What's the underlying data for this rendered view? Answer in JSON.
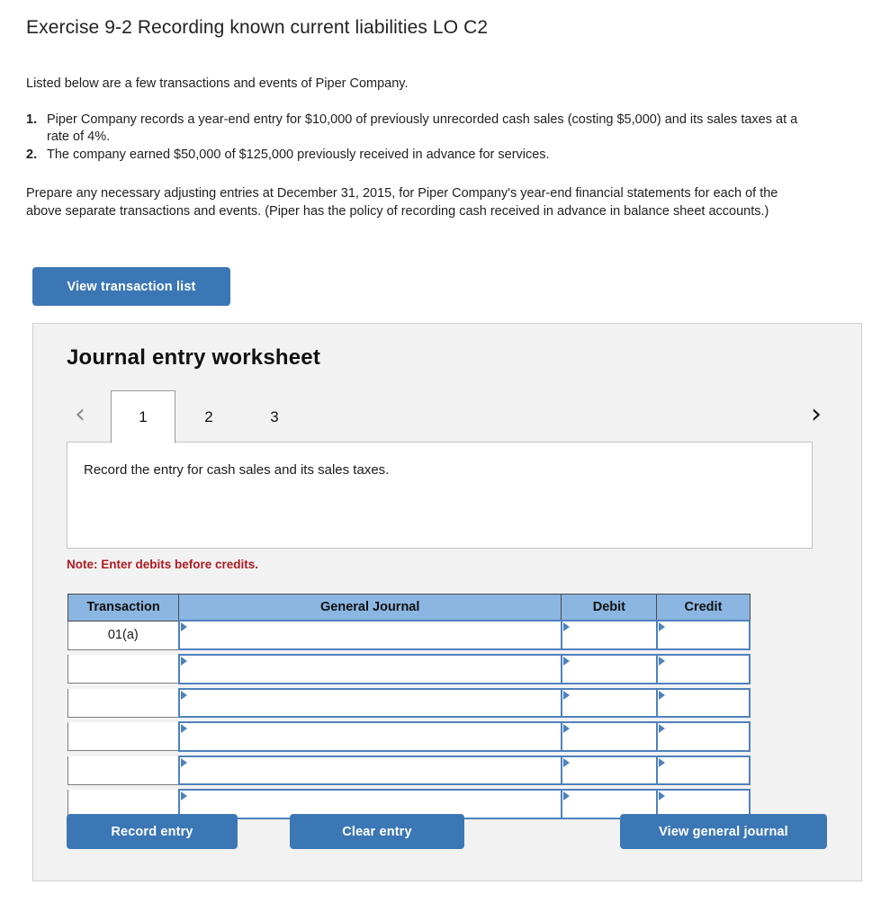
{
  "exercise": {
    "title": "Exercise 9-2 Recording known current liabilities LO C2",
    "intro": "Listed below are a few transactions and events of Piper Company.",
    "facts": [
      {
        "marker": "1.",
        "text": "Piper Company records a year-end entry for $10,000 of previously unrecorded cash sales (costing $5,000) and its sales taxes at a rate of 4%."
      },
      {
        "marker": "2.",
        "text": "The company earned $50,000 of $125,000 previously received in advance for services."
      }
    ],
    "prepare": "Prepare any necessary adjusting entries at December 31, 2015, for Piper Company's year-end financial statements for each of the above separate transactions and events. (Piper has the policy of recording cash received in advance in balance sheet accounts.)",
    "view_transaction_list_label": "View transaction list"
  },
  "worksheet": {
    "title": "Journal entry worksheet",
    "prev_arrow": "‹",
    "next_arrow": "›",
    "tabs": [
      {
        "label": "1",
        "active": true
      },
      {
        "label": "2",
        "active": false
      },
      {
        "label": "3",
        "active": false
      }
    ],
    "instruction": "Record the entry for cash sales and its sales taxes.",
    "note": "Note: Enter debits before credits.",
    "table": {
      "headers": [
        "Transaction",
        "General Journal",
        "Debit",
        "Credit"
      ],
      "rows": [
        {
          "transaction": "01(a)",
          "general_journal": "",
          "debit": "",
          "credit": ""
        },
        {
          "transaction": "",
          "general_journal": "",
          "debit": "",
          "credit": ""
        },
        {
          "transaction": "",
          "general_journal": "",
          "debit": "",
          "credit": ""
        },
        {
          "transaction": "",
          "general_journal": "",
          "debit": "",
          "credit": ""
        },
        {
          "transaction": "",
          "general_journal": "",
          "debit": "",
          "credit": ""
        },
        {
          "transaction": "",
          "general_journal": "",
          "debit": "",
          "credit": ""
        }
      ]
    },
    "buttons": {
      "record_entry": "Record entry",
      "clear_entry": "Clear entry",
      "view_general_journal": "View general journal"
    }
  },
  "colors": {
    "button_blue": "#3c77b5",
    "table_header_blue": "#8cb6e2",
    "input_border_blue": "#4f81bd",
    "note_red": "#ad1c22",
    "panel_gray": "#f2f2f2"
  }
}
